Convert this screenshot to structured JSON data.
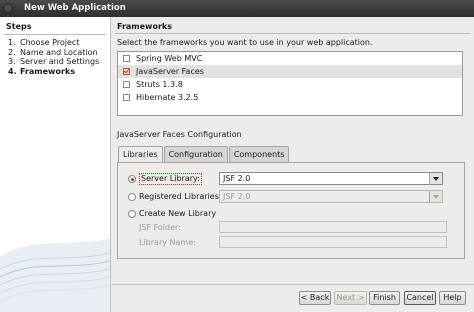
{
  "window": {
    "title": "New Web Application"
  },
  "steps": {
    "heading": "Steps",
    "items": [
      {
        "num": "1.",
        "label": "Choose Project",
        "current": false
      },
      {
        "num": "2.",
        "label": "Name and Location",
        "current": false
      },
      {
        "num": "3.",
        "label": "Server and Settings",
        "current": false
      },
      {
        "num": "4.",
        "label": "Frameworks",
        "current": true
      }
    ]
  },
  "frameworks": {
    "heading": "Frameworks",
    "instruction": "Select the frameworks you want to use in your web application.",
    "items": [
      {
        "label": "Spring Web MVC",
        "checked": false,
        "selected": false
      },
      {
        "label": "JavaServer Faces",
        "checked": true,
        "selected": true
      },
      {
        "label": "Struts 1.3.8",
        "checked": false,
        "selected": false
      },
      {
        "label": "Hibernate 3.2.5",
        "checked": false,
        "selected": false
      }
    ]
  },
  "config": {
    "heading": "JavaServer Faces Configuration",
    "tabs": [
      {
        "label": "Libraries",
        "active": true
      },
      {
        "label": "Configuration",
        "active": false
      },
      {
        "label": "Components",
        "active": false
      }
    ],
    "server_library": {
      "label": "Server Library:",
      "selected": true,
      "value": "JSF 2.0"
    },
    "registered_libraries": {
      "label": "Registered Libraries:",
      "selected": false,
      "value": "JSF 2.0"
    },
    "create_library": {
      "label": "Create New Library",
      "selected": false
    },
    "jsf_folder": {
      "label": "JSF Folder:",
      "value": ""
    },
    "library_name": {
      "label": "Library Name:",
      "value": ""
    }
  },
  "buttons": {
    "back": "< Back",
    "next": "Next >",
    "finish": "Finish",
    "cancel": "Cancel",
    "help": "Help"
  },
  "colors": {
    "accent": "#c6311b",
    "titlebar": "#3a3a3a",
    "window_bg": "#edeceb"
  }
}
